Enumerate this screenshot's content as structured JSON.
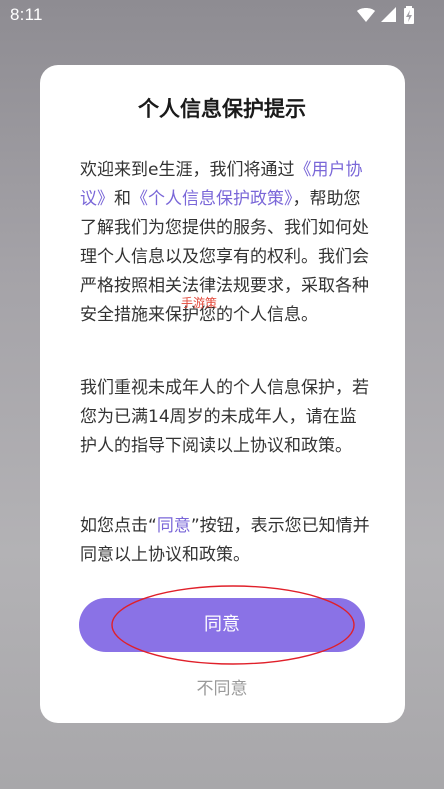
{
  "status_bar": {
    "time": "8:11",
    "icons": [
      "wifi-icon",
      "signal-icon",
      "battery-charging-icon"
    ]
  },
  "dialog": {
    "title": "个人信息保护提示",
    "paragraph1": {
      "text_before": "欢迎来到e生涯，我们将通过",
      "link_user_agreement": "《用户协议》",
      "text_and": "和",
      "link_privacy_policy": "《个人信息保护政策》",
      "text_after": "，帮助您了解我们为您提供的服务、我们如何处理个人信息以及您享有的权利。我们会严格按照相关法律法规要求，采取各种安全措施来保护您的个人信息。"
    },
    "paragraph2": "我们重视未成年人的个人信息保护，若您为已满14周岁的未成年人，请在监护人的指导下阅读以上协议和政策。",
    "paragraph3": {
      "text_before": "如您点击“",
      "agree_highlight": "同意",
      "text_after": "”按钮，表示您已知情并同意以上协议和政策。"
    },
    "watermark": "手游策",
    "agree_button": "同意",
    "disagree_button": "不同意"
  },
  "colors": {
    "accent": "#8a72e6",
    "link": "#7a67d8",
    "annotation": "#e0202a"
  }
}
